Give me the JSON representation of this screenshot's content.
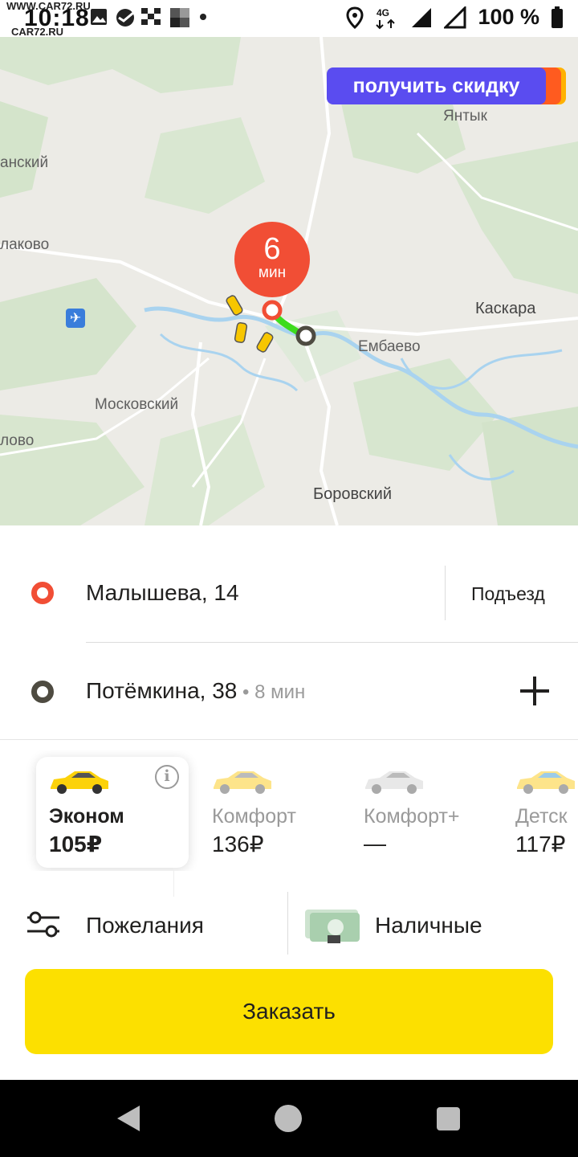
{
  "status_bar": {
    "time": "10:18",
    "watermark_top": "WWW.CAR72.RU",
    "watermark_bottom": "CAR72.RU",
    "network": "4G",
    "battery": "100 %"
  },
  "map": {
    "promo_label": "получить скидку",
    "eta_value": "6",
    "eta_unit": "мин",
    "places": {
      "yantyk": "Янтык",
      "anskiy": "анский",
      "lakovo": "лаково",
      "kaskara": "Каскара",
      "embaevo": "Ембаево",
      "moskovskiy": "Московский",
      "lovo": "лово",
      "borovskiy": "Боровский"
    }
  },
  "route": {
    "from": "Малышева, 14",
    "entrance_label": "Подъезд",
    "to": "Потёмкина, 38",
    "to_eta": " • 8 мин"
  },
  "tariffs": [
    {
      "name": "Эконом",
      "price": "105₽",
      "selected": true,
      "car_color": "#fcd20a"
    },
    {
      "name": "Комфорт",
      "price": "136₽",
      "selected": false,
      "car_color": "#fde48a"
    },
    {
      "name": "Комфорт+",
      "price": "—",
      "selected": false,
      "car_color": "#e8e8e8"
    },
    {
      "name": "Детск",
      "price": "117₽",
      "selected": false,
      "car_color": "#fde48a"
    }
  ],
  "options": {
    "wishes_label": "Пожелания",
    "payment_label": "Наличные"
  },
  "order_button": "Заказать",
  "colors": {
    "accent_yellow": "#fce000",
    "route_red": "#f14e35",
    "promo_purple": "#5a4cf0",
    "route_green": "#3ddc1e"
  }
}
